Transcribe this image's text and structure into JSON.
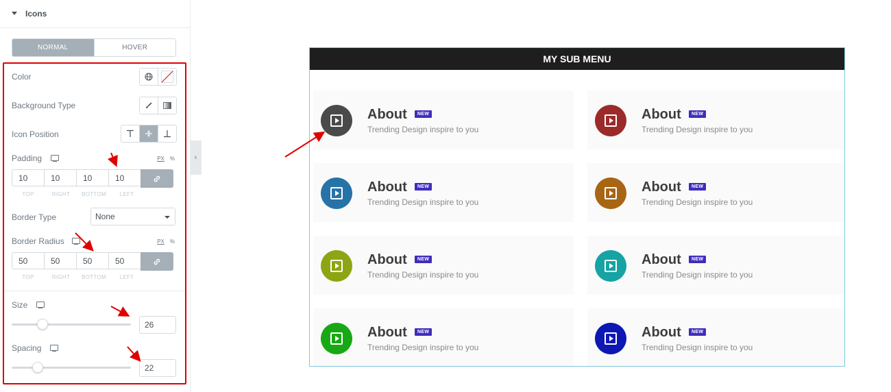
{
  "panel": {
    "section_title": "Icons",
    "tabs": [
      {
        "label": "NORMAL"
      },
      {
        "label": "HOVER"
      }
    ],
    "color_label": "Color",
    "background_type_label": "Background Type",
    "icon_position_label": "Icon Position",
    "padding": {
      "label": "Padding",
      "unit_px": "PX",
      "unit_pct": "%",
      "values": [
        "10",
        "10",
        "10",
        "10"
      ],
      "sides": [
        "TOP",
        "RIGHT",
        "BOTTOM",
        "LEFT"
      ]
    },
    "border_type": {
      "label": "Border Type",
      "value": "None"
    },
    "border_radius": {
      "label": "Border Radius",
      "unit_px": "PX",
      "unit_pct": "%",
      "values": [
        "50",
        "50",
        "50",
        "50"
      ],
      "sides": [
        "TOP",
        "RIGHT",
        "BOTTOM",
        "LEFT"
      ]
    },
    "size": {
      "label": "Size",
      "value": "26"
    },
    "spacing": {
      "label": "Spacing",
      "value": "22"
    }
  },
  "preview": {
    "menu_title": "MY SUB MENU",
    "items": [
      {
        "title": "About",
        "badge": "NEW",
        "desc": "Trending Design inspire to you",
        "color": "#4a4a4a"
      },
      {
        "title": "About",
        "badge": "NEW",
        "desc": "Trending Design inspire to you",
        "color": "#9b2a2a"
      },
      {
        "title": "About",
        "badge": "NEW",
        "desc": "Trending Design inspire to you",
        "color": "#2673a8"
      },
      {
        "title": "About",
        "badge": "NEW",
        "desc": "Trending Design inspire to you",
        "color": "#a86514"
      },
      {
        "title": "About",
        "badge": "NEW",
        "desc": "Trending Design inspire to you",
        "color": "#8ea513"
      },
      {
        "title": "About",
        "badge": "NEW",
        "desc": "Trending Design inspire to you",
        "color": "#16a3a3"
      },
      {
        "title": "About",
        "badge": "NEW",
        "desc": "Trending Design inspire to you",
        "color": "#18a815"
      },
      {
        "title": "About",
        "badge": "NEW",
        "desc": "Trending Design inspire to you",
        "color": "#0d17b3"
      }
    ]
  },
  "colors": {
    "highlight": "#e00000",
    "tab_active": "#a4afb7",
    "badge": "#3f2dbd"
  }
}
